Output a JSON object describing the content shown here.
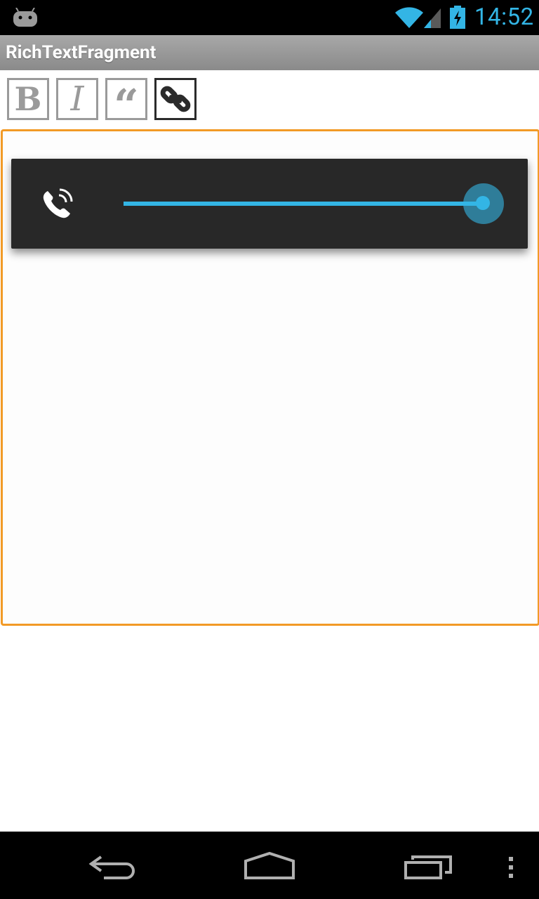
{
  "status_bar": {
    "time": "14:52",
    "icons": [
      "android-icon",
      "wifi-icon",
      "signal-icon",
      "battery-charging-icon"
    ],
    "accent": "#33b5e5"
  },
  "action_bar": {
    "title": "RichTextFragment"
  },
  "format_toolbar": {
    "bold_label": "B",
    "italic_label": "I",
    "quote_label": "“",
    "link_icon": "link-icon",
    "active": "link"
  },
  "editor": {
    "border_color": "#f29a26",
    "text": ""
  },
  "volume_panel": {
    "stream_icon": "phone-call-icon",
    "level": 1.0
  },
  "nav_bar": {
    "icons": [
      "back-icon",
      "home-icon",
      "recents-icon",
      "menu-icon"
    ]
  }
}
